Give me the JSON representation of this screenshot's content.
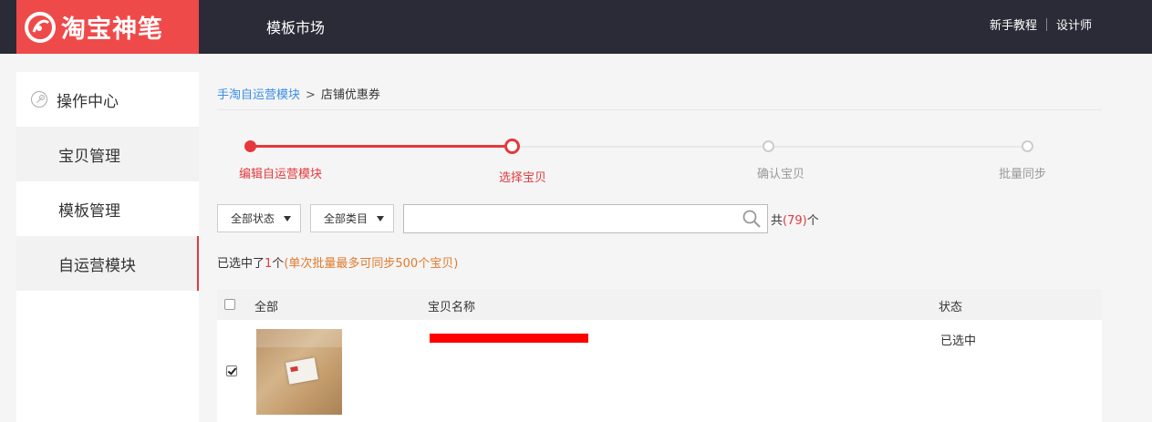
{
  "header": {
    "logo_text": "淘宝神笔",
    "nav_title": "模板市场",
    "links": [
      "新手教程",
      "设计师"
    ]
  },
  "sidebar": {
    "items": [
      {
        "label": "操作中心",
        "icon": "key-icon"
      },
      {
        "label": "宝贝管理"
      },
      {
        "label": "模板管理"
      },
      {
        "label": "自运营模块",
        "active": true
      }
    ]
  },
  "breadcrumb": {
    "parent": "手淘自运营模块",
    "separator": ">",
    "current": "店铺优惠券"
  },
  "steps": [
    {
      "label": "编辑自运营模块",
      "state": "done"
    },
    {
      "label": "选择宝贝",
      "state": "current"
    },
    {
      "label": "确认宝贝",
      "state": "todo"
    },
    {
      "label": "批量同步",
      "state": "todo"
    }
  ],
  "filters": {
    "status_select": "全部状态",
    "category_select": "全部类目",
    "search_value": "",
    "count_prefix": "共",
    "count_value": "(79)",
    "count_suffix": "个"
  },
  "selection": {
    "prefix": "已选中了",
    "count": "1",
    "unit": "个",
    "hint": "(单次批量最多可同步500个宝贝)"
  },
  "table": {
    "headers": {
      "all": "全部",
      "name": "宝贝名称",
      "status": "状态"
    },
    "rows": [
      {
        "checked": true,
        "status": "已选中"
      }
    ]
  },
  "colors": {
    "accent": "#e4393c",
    "logo_bg": "#ef4a4a",
    "topbar_bg": "#2b2b38",
    "link": "#3a8ee6",
    "hint": "#e07a2d"
  }
}
